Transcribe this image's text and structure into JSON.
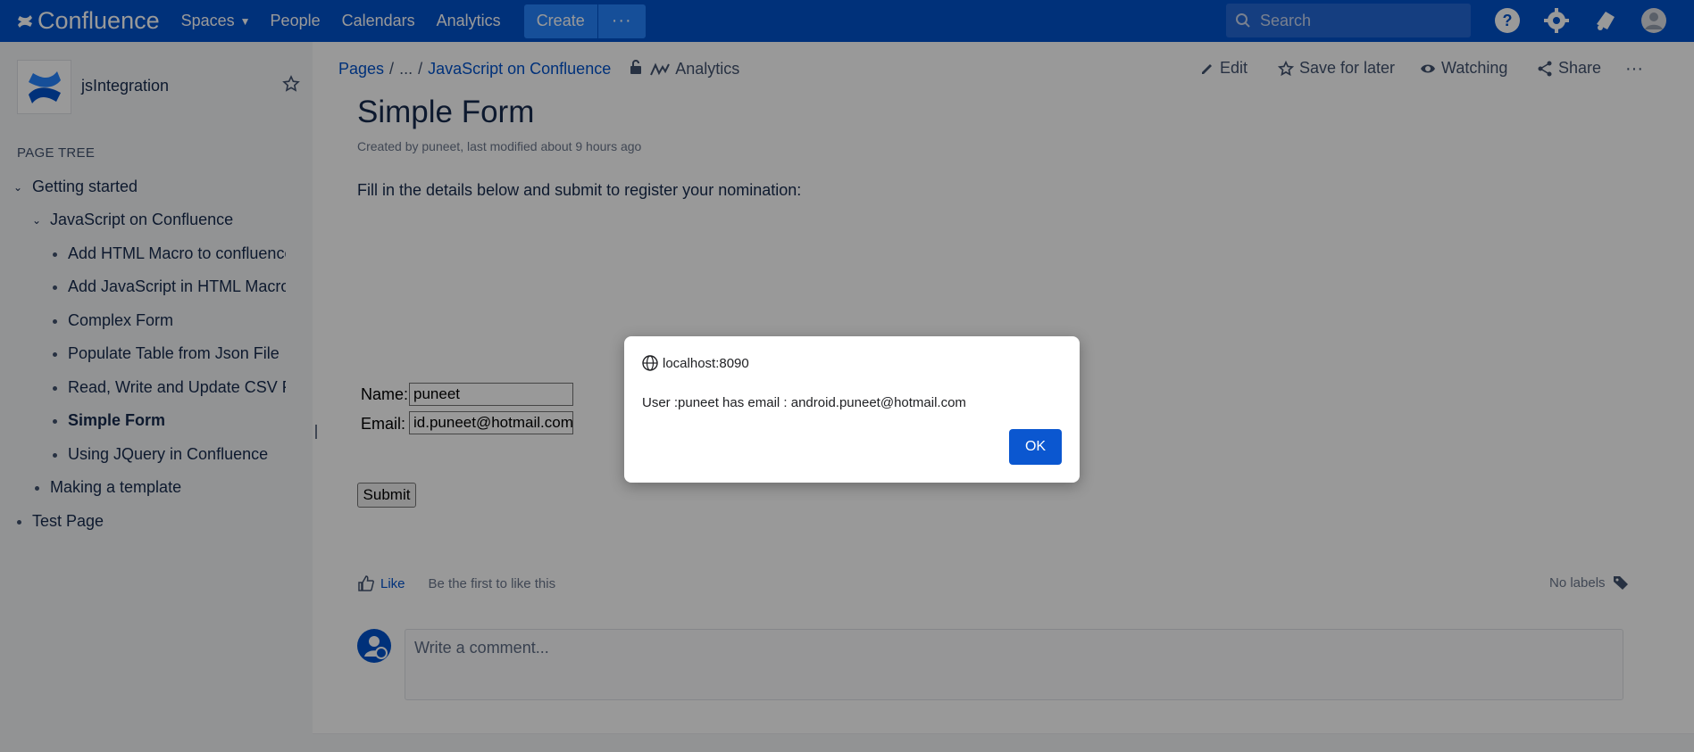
{
  "topnav": {
    "brand": "Confluence",
    "items": [
      {
        "label": "Spaces"
      },
      {
        "label": "People"
      },
      {
        "label": "Calendars"
      },
      {
        "label": "Analytics"
      }
    ],
    "create_label": "Create",
    "more_label": "···",
    "search_placeholder": "Search",
    "icons": [
      "help-icon",
      "settings-icon",
      "notifications-icon",
      "avatar-icon"
    ]
  },
  "sidebar": {
    "space_name": "jsIntegration",
    "page_tree_label": "PAGE TREE",
    "tree": [
      {
        "label": "Getting started"
      },
      {
        "label": "JavaScript on Confluence"
      },
      {
        "label": "Add HTML Macro to confluence"
      },
      {
        "label": "Add JavaScript in HTML Macro"
      },
      {
        "label": "Complex Form"
      },
      {
        "label": "Populate Table from Json File"
      },
      {
        "label": "Read, Write and Update CSV File"
      },
      {
        "label": "Simple Form"
      },
      {
        "label": "Using JQuery in Confluence"
      },
      {
        "label": "Making a template"
      },
      {
        "label": "Test Page"
      }
    ]
  },
  "breadcrumb": {
    "pages": "Pages",
    "ellipsis": "...",
    "parent": "JavaScript on Confluence",
    "analytics": "Analytics"
  },
  "page_actions": {
    "edit": "Edit",
    "save_for_later": "Save for later",
    "watching": "Watching",
    "share": "Share",
    "more": "···"
  },
  "page": {
    "title": "Simple Form",
    "byline": "Created by puneet, last modified about 9 hours ago",
    "intro": "Fill in the details below and submit to register your nomination:"
  },
  "form": {
    "name_label": "Name:",
    "name_value": "puneet",
    "email_label": "Email:",
    "email_value": "id.puneet@hotmail.com",
    "submit_label": "Submit"
  },
  "footer": {
    "like_label": "Like",
    "like_text": "Be the first to like this",
    "labels_text": "No labels",
    "comment_placeholder": "Write a comment..."
  },
  "dialog": {
    "origin": "localhost:8090",
    "message": "User :puneet has email : android.puneet@hotmail.com",
    "ok_label": "OK"
  },
  "colors": {
    "brand_blue": "#0052cc",
    "create_button": "#2684ff",
    "dialog_button": "#0b57d0"
  }
}
